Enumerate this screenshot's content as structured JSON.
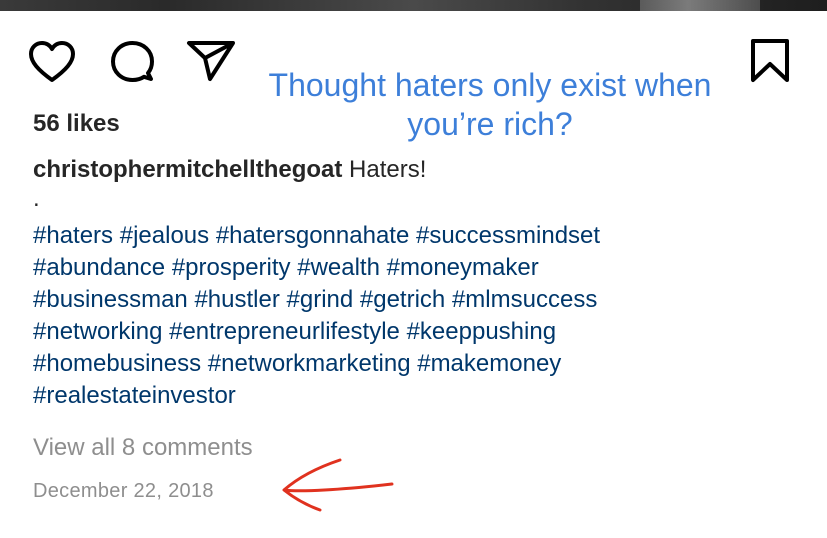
{
  "post": {
    "likes": "56 likes",
    "username": "christophermitchellthegoat",
    "caption_text": "Haters!",
    "dot": ".",
    "hashtags": [
      "#haters",
      "#jealous",
      "#hatersgonnahate",
      "#successmindset",
      "#abundance",
      "#prosperity",
      "#wealth",
      "#moneymaker",
      "#businessman",
      "#hustler",
      "#grind",
      "#getrich",
      "#mlmsuccess",
      "#networking",
      "#entrepreneurlifestyle",
      "#keeppushing",
      "#homebusiness",
      "#networkmarketing",
      "#makemoney",
      "#realestateinvestor"
    ],
    "view_comments": "View all 8 comments",
    "date": "December 22, 2018"
  },
  "icons": {
    "like": "heart-icon",
    "comment": "speech-bubble-icon",
    "share": "paper-plane-icon",
    "save": "bookmark-icon"
  },
  "annotation": {
    "text": "Thought haters only exist when you’re rich?",
    "color": "#3d7fd9"
  },
  "colors": {
    "hashtag": "#00376b",
    "muted": "#8e8e8e",
    "arrow": "#e0321f"
  }
}
